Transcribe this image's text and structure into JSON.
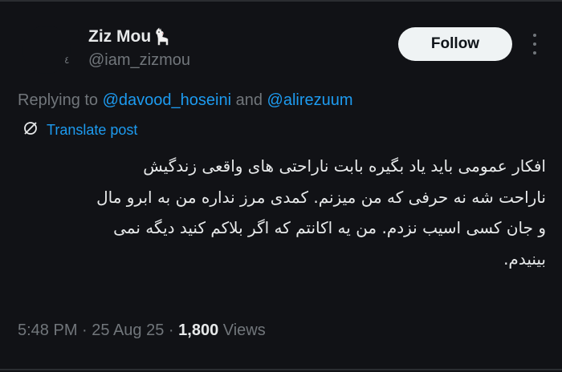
{
  "author": {
    "display_name": "Ziz Mou",
    "handle": "@iam_zizmou",
    "emoji_icon": "llama-icon"
  },
  "actions": {
    "follow_label": "Follow",
    "more_icon": "more-vertical-icon"
  },
  "reply": {
    "prefix": "Replying to ",
    "mention_1": "@davood_hoseini",
    "conjunction": " and ",
    "mention_2": "@alirezuum"
  },
  "translate": {
    "label": "Translate post",
    "icon": "translate-icon"
  },
  "post": {
    "lines": [
      "افکار عمومی باید یاد بگیره بابت ناراحتی های واقعی زندگیش",
      "ناراحت شه نه حرفی که من میزنم. کمدی مرز نداره من به ابرو مال",
      "و جان کسی اسیب نزدم. من یه اکانتم که اگر بلاکم کنید دیگه نمی",
      "بینیدم."
    ]
  },
  "meta": {
    "time": "5:48 PM",
    "sep1": " · ",
    "date": "25 Aug 25",
    "sep2": " · ",
    "views_count": "1,800",
    "views_label": " Views"
  },
  "colors": {
    "background": "#111216",
    "text": "#e7e9ea",
    "muted": "#71767b",
    "link": "#1d9bf0",
    "button_bg": "#eff3f4"
  }
}
